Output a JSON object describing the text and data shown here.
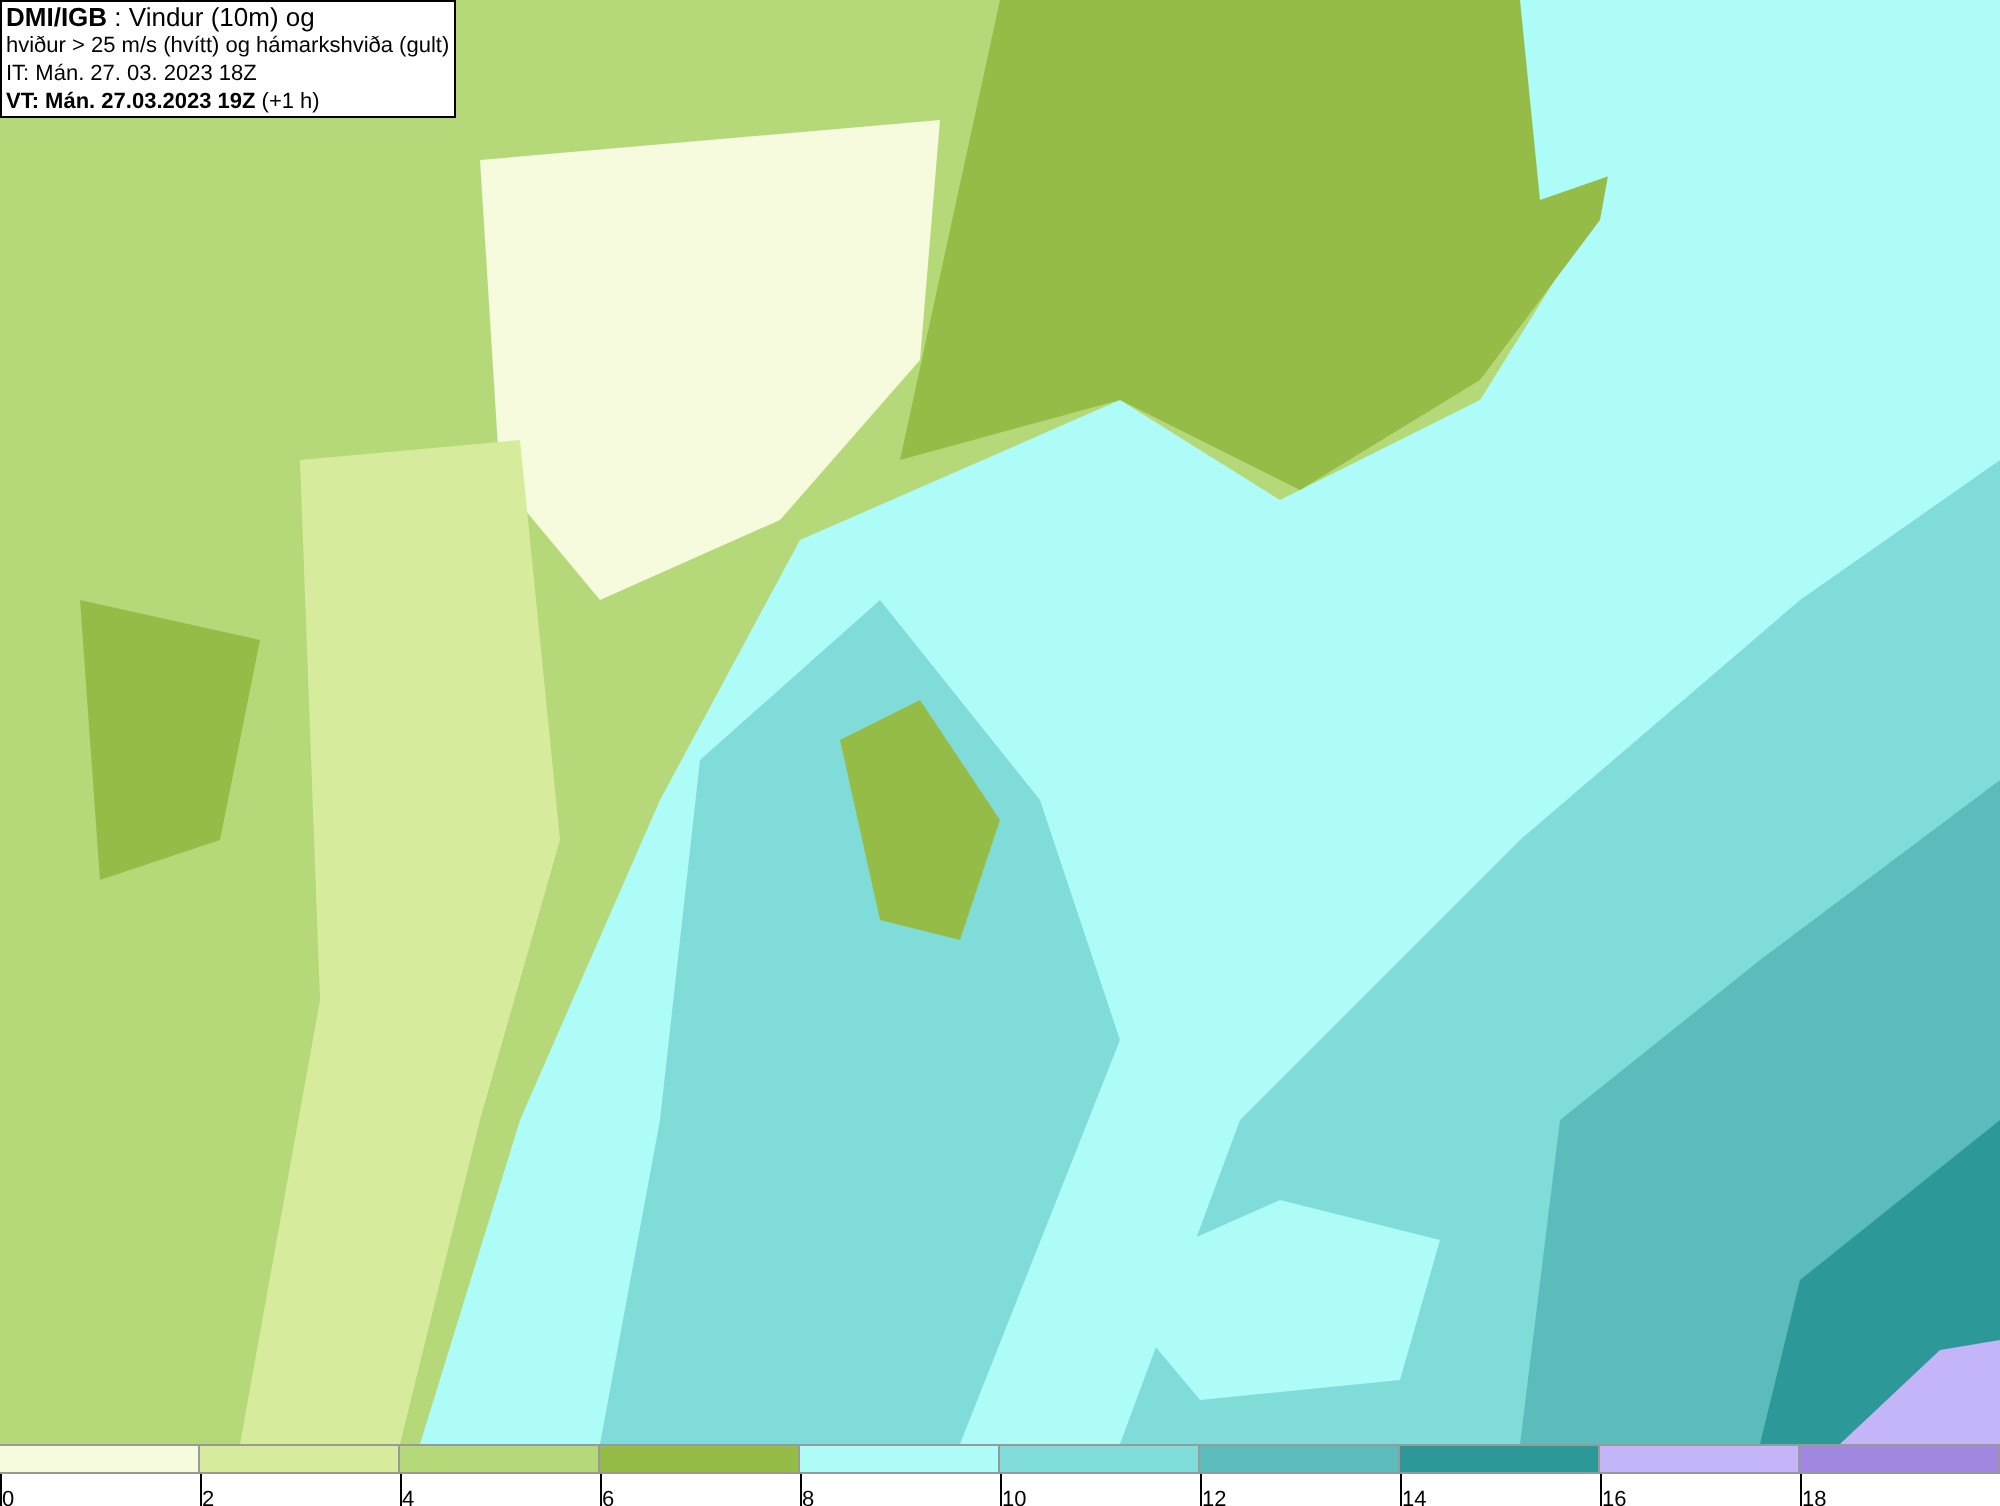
{
  "info_box": {
    "lines": [
      "**DMI/IGB** : Vindur (10m) og",
      "hviður > 25 m/s (hvítt) og hámarkshviða (gult)",
      "IT: Mán. 27. 03. 2023 18Z",
      "**VT: Mán. 27.03.2023 19Z** (+1 h)"
    ]
  },
  "legend": [
    {
      "label": "0",
      "color": "#f5fbdc"
    },
    {
      "label": "2",
      "color": "#d6ec9c"
    },
    {
      "label": "4",
      "color": "#b5d878"
    },
    {
      "label": "6",
      "color": "#96bc48"
    },
    {
      "label": "8",
      "color": "#aefcf8"
    },
    {
      "label": "10",
      "color": "#80dcd8"
    },
    {
      "label": "12",
      "color": "#5cbcbc"
    },
    {
      "label": "14",
      "color": "#2c9898"
    },
    {
      "label": "16",
      "color": "#c4b4f8"
    },
    {
      "label": "18",
      "color": "#a088e0"
    }
  ]
}
